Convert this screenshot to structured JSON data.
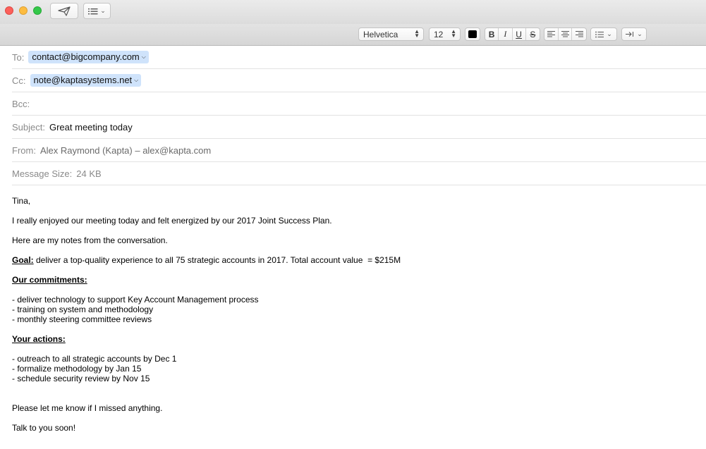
{
  "toolbar": {
    "send_icon": "paper-plane-icon",
    "header_fields_icon": "list-icon"
  },
  "format": {
    "font": "Helvetica",
    "size": "12",
    "color": "#000000",
    "bold": "B",
    "italic": "I",
    "underline": "U",
    "strike": "S"
  },
  "header": {
    "to_label": "To:",
    "to_value": "contact@bigcompany.com",
    "cc_label": "Cc:",
    "cc_value": "note@kaptasystems.net",
    "bcc_label": "Bcc:",
    "subject_label": "Subject:",
    "subject_value": "Great meeting today",
    "from_label": "From:",
    "from_value": "Alex Raymond (Kapta) – alex@kapta.com",
    "size_label": "Message Size:",
    "size_value": "24 KB"
  },
  "body": {
    "greeting": "Tina,",
    "line1": "I really enjoyed our meeting today and felt energized by our 2017 Joint Success Plan.",
    "line2": "Here are my notes from the conversation.",
    "goal_label": "Goal:",
    "goal_text": " deliver a top-quality experience to all 75 strategic accounts in 2017. Total account value  = $215M",
    "commitments_heading": "Our commitments:",
    "commitments": [
      "- deliver technology to support Key Account Management process",
      "- training on system and methodology",
      "- monthly steering committee reviews"
    ],
    "actions_heading": "Your actions:",
    "actions": [
      "- outreach to all strategic accounts by Dec 1",
      "- formalize methodology by Jan 15",
      "- schedule security review by Nov 15"
    ],
    "closing1": "Please let me know if I missed anything.",
    "closing2": "Talk to you soon!"
  }
}
